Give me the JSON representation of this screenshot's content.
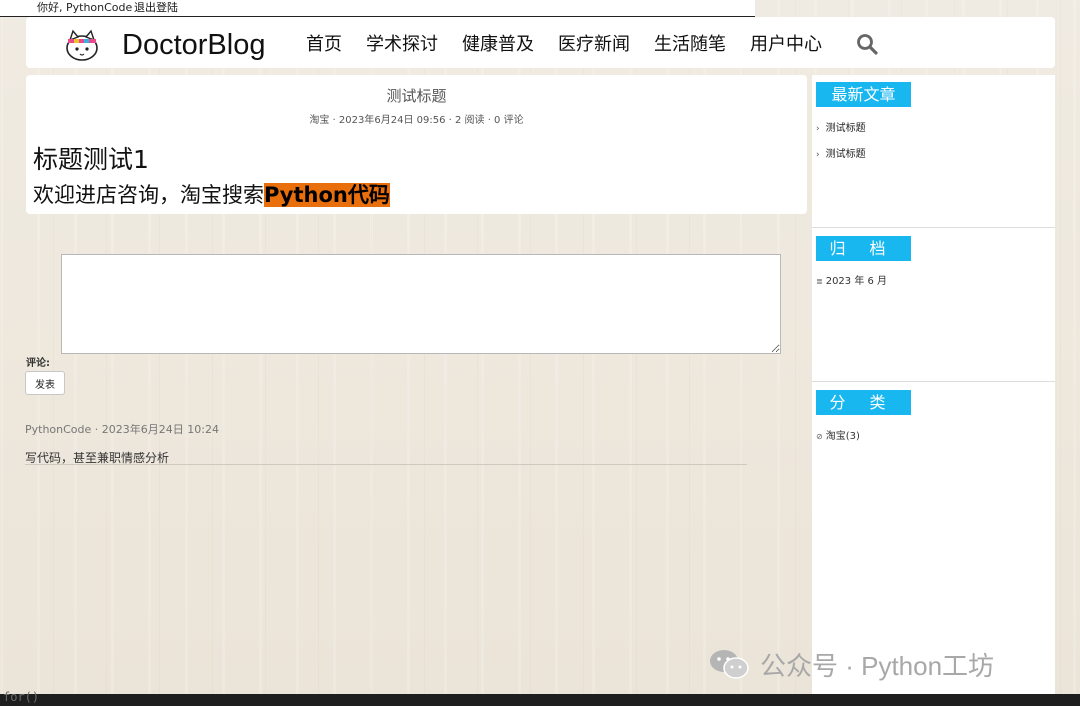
{
  "topbar": {
    "greeting": "你好, PythonCode",
    "logout": "退出登陆"
  },
  "header": {
    "brand": "DoctorBlog",
    "nav": [
      "首页",
      "学术探讨",
      "健康普及",
      "医疗新闻",
      "生活随笔",
      "用户中心"
    ],
    "search_icon": "search-icon"
  },
  "article": {
    "title": "测试标题",
    "meta": "淘宝 · 2023年6月24日 09:56 · 2 阅读 · 0 评论",
    "heading": "标题测试1",
    "body_prefix": "欢迎进店咨询，淘宝搜索",
    "body_highlight": "Python代码",
    "highlight_color": "#e86f0b"
  },
  "comment_form": {
    "value": "",
    "label": "评论:",
    "submit": "发表"
  },
  "comments": [
    {
      "meta": "PythonCode · 2023年6月24日 10:24",
      "text": "写代码，甚至兼职情感分析"
    }
  ],
  "sidebar": {
    "accent": "#19b7f0",
    "recent": {
      "title": "最新文章",
      "items": [
        "测试标题",
        "测试标题"
      ]
    },
    "archive": {
      "title": "归档",
      "items": [
        "2023 年 6 月"
      ]
    },
    "category": {
      "title": "分类",
      "items": [
        "淘宝(3)"
      ]
    }
  },
  "watermark": "公众号 · Python工坊",
  "code_peek": "for()"
}
